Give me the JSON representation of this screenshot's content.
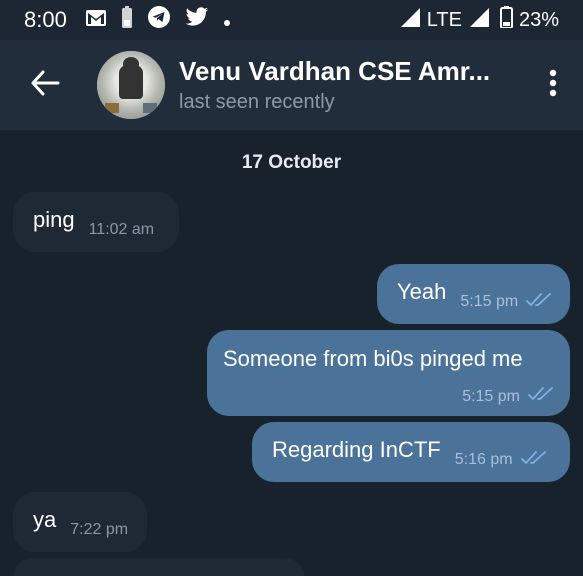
{
  "status_bar": {
    "time": "8:00",
    "network": "LTE",
    "battery": "23%",
    "icons": [
      "gmail-icon",
      "battery-alert-icon",
      "telegram-icon",
      "twitter-icon",
      "dot-icon",
      "signal-icon",
      "battery-icon"
    ]
  },
  "header": {
    "title": "Venu Vardhan CSE Amr...",
    "subtitle": "last seen recently"
  },
  "chat": {
    "date": "17 October",
    "messages": [
      {
        "direction": "in",
        "text": "ping",
        "time": "11:02 am"
      },
      {
        "direction": "out",
        "text": "Yeah",
        "time": "5:15 pm",
        "read": true
      },
      {
        "direction": "out",
        "text": "Someone from bi0s pinged me",
        "time": "5:15 pm",
        "read": true
      },
      {
        "direction": "out",
        "text": "Regarding InCTF",
        "time": "5:16 pm",
        "read": true
      },
      {
        "direction": "in",
        "text": "ya",
        "time": "7:22 pm"
      }
    ]
  },
  "colors": {
    "background": "#18222d",
    "header": "#212d3b",
    "incoming_bubble": "#1f2936",
    "outgoing_bubble": "#4b7399",
    "read_ticks": "#7fb0e6"
  }
}
